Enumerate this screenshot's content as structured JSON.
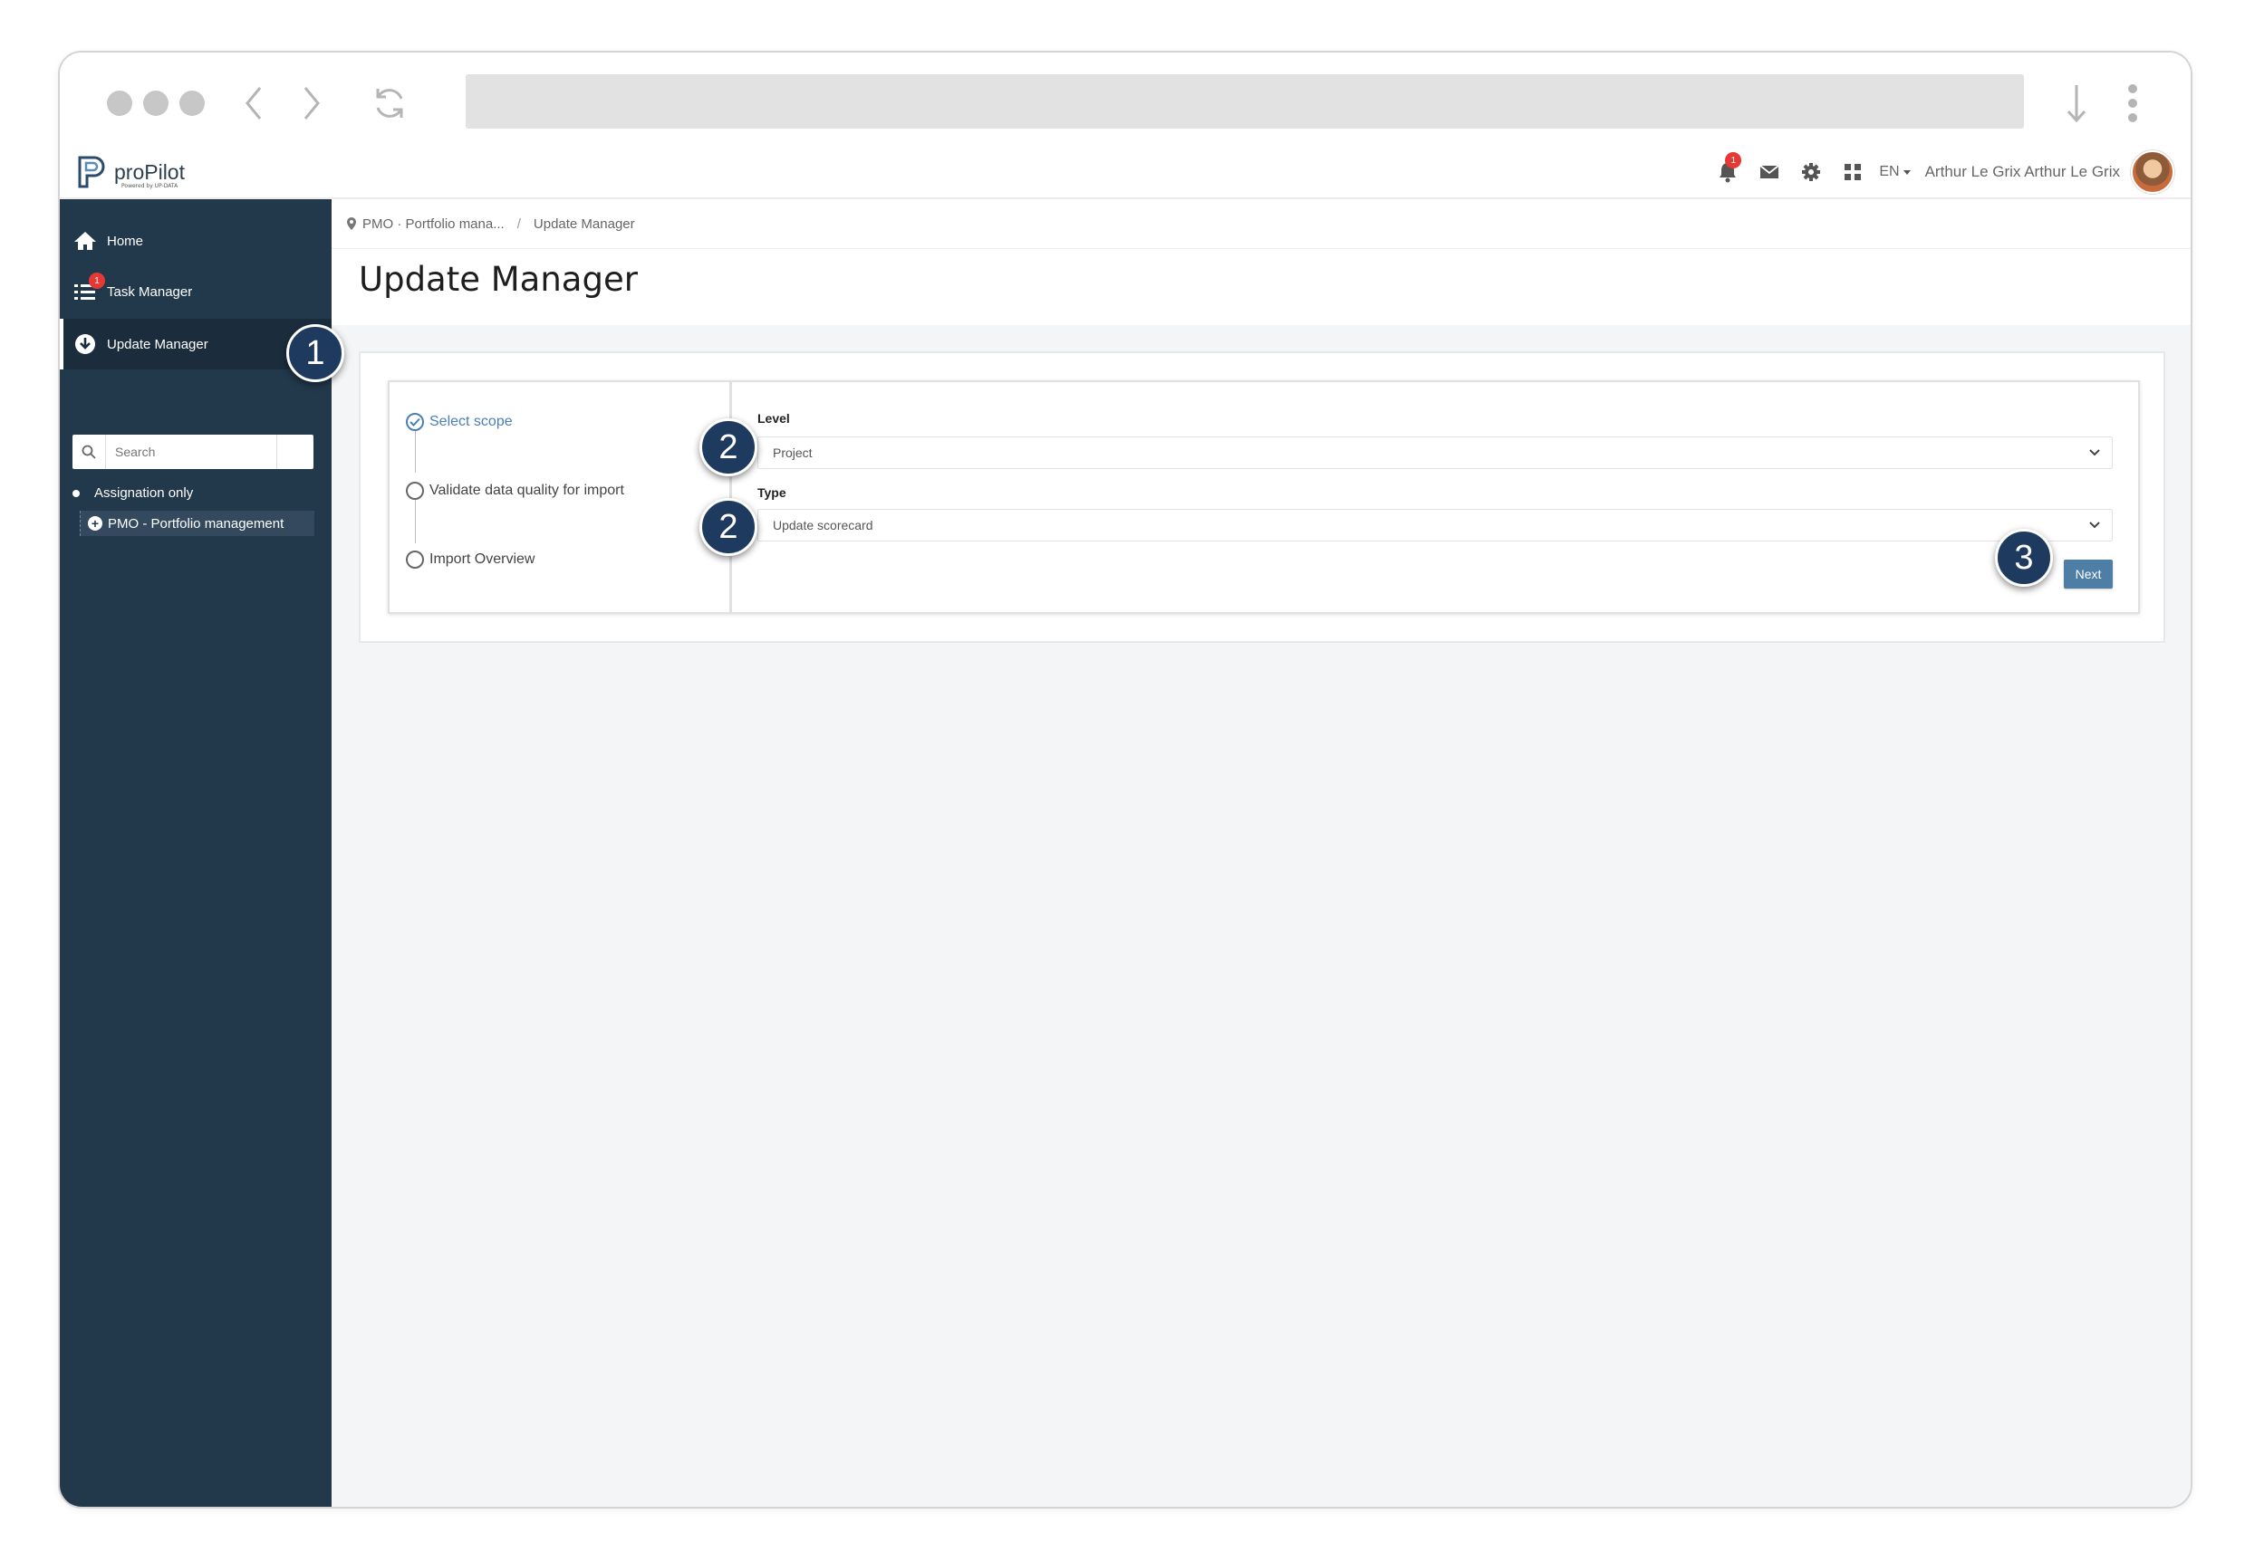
{
  "app": {
    "logo_text": "proPilot",
    "logo_subtext": "Powered by UP-DATA"
  },
  "header": {
    "notification_count": "1",
    "language": "EN",
    "user_name": "Arthur Le Grix Arthur Le Grix"
  },
  "sidebar": {
    "items": [
      {
        "label": "Home",
        "icon": "home-icon"
      },
      {
        "label": "Task Manager",
        "icon": "task-list-icon",
        "badge": "1"
      },
      {
        "label": "Update Manager",
        "icon": "download-circle-icon"
      }
    ],
    "search_placeholder": "Search",
    "tree": {
      "root": "Assignation only",
      "child": "PMO - Portfolio management"
    }
  },
  "breadcrumb": {
    "part1": "PMO · Portfolio mana...",
    "separator": "/",
    "part2": "Update Manager"
  },
  "page": {
    "title": "Update Manager"
  },
  "wizard": {
    "steps": [
      {
        "label": "Select scope",
        "state": "done"
      },
      {
        "label": "Validate data quality for import",
        "state": "pending"
      },
      {
        "label": "Import Overview",
        "state": "pending"
      }
    ],
    "level_label": "Level",
    "level_value": "Project",
    "type_label": "Type",
    "type_value": "Update scorecard",
    "next_label": "Next"
  },
  "markers": [
    "1",
    "2",
    "2",
    "3"
  ],
  "colors": {
    "sidebar_bg": "#22384b",
    "accent": "#4e7ea6",
    "marker": "#1e3a5f",
    "badge": "#e53935"
  }
}
